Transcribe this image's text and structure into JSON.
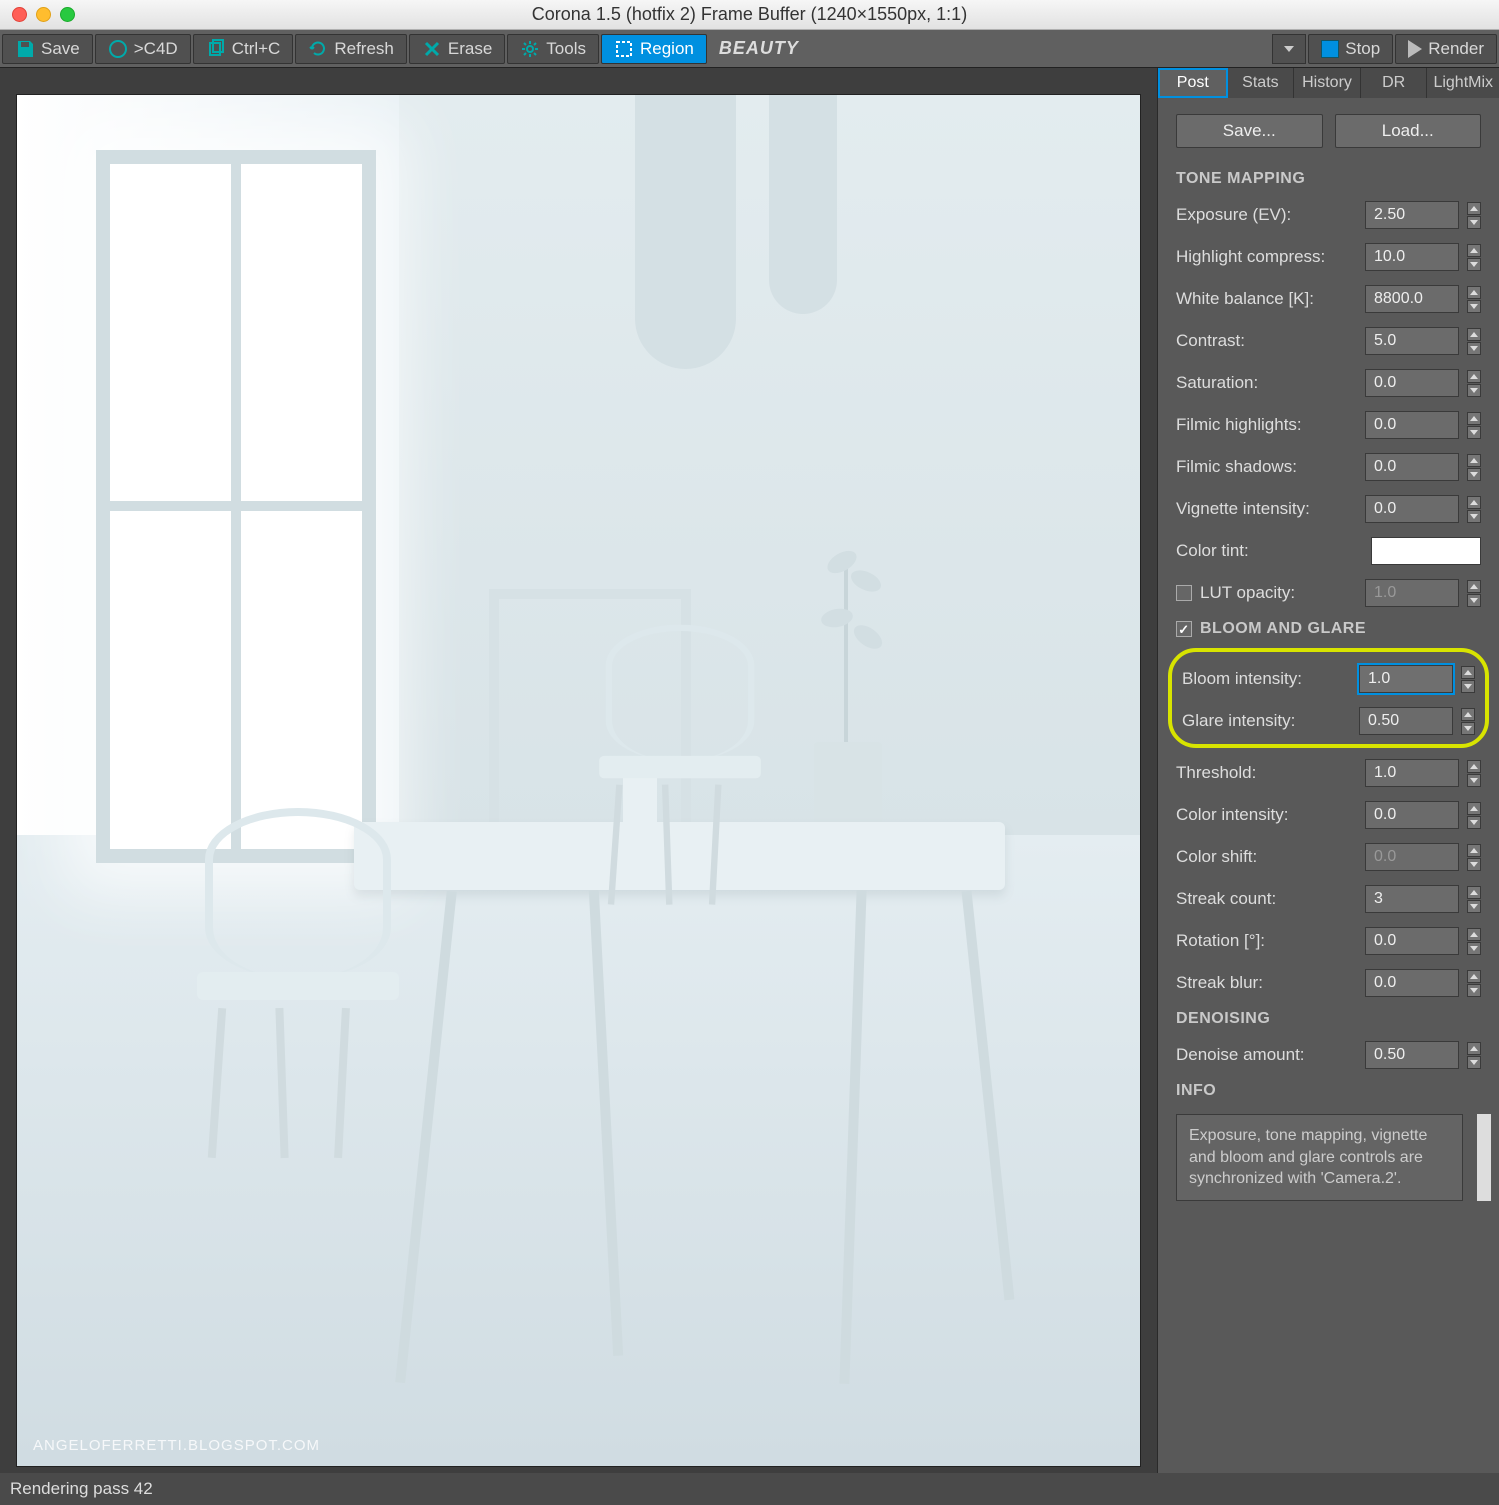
{
  "window": {
    "title": "Corona 1.5 (hotfix 2) Frame Buffer (1240×1550px, 1:1)"
  },
  "toolbar": {
    "save": "Save",
    "c4d": ">C4D",
    "copy": "Ctrl+C",
    "refresh": "Refresh",
    "erase": "Erase",
    "tools": "Tools",
    "region": "Region",
    "pass": "BEAUTY",
    "stop": "Stop",
    "render": "Render"
  },
  "viewport": {
    "watermark": "ANGELOFERRETTI.BLOGSPOT.COM"
  },
  "tabs": {
    "post": "Post",
    "stats": "Stats",
    "history": "History",
    "dr": "DR",
    "lightmix": "LightMix"
  },
  "panel": {
    "save": "Save...",
    "load": "Load...",
    "sections": {
      "tone": "TONE MAPPING",
      "bloom": "BLOOM AND GLARE",
      "denoise": "DENOISING",
      "info": "INFO"
    },
    "tone": {
      "exposure_label": "Exposure (EV):",
      "exposure": "2.50",
      "highlight_label": "Highlight compress:",
      "highlight": "10.0",
      "wb_label": "White balance [K]:",
      "wb": "8800.0",
      "contrast_label": "Contrast:",
      "contrast": "5.0",
      "saturation_label": "Saturation:",
      "saturation": "0.0",
      "filmic_hl_label": "Filmic highlights:",
      "filmic_hl": "0.0",
      "filmic_sh_label": "Filmic shadows:",
      "filmic_sh": "0.0",
      "vignette_label": "Vignette intensity:",
      "vignette": "0.0",
      "tint_label": "Color tint:",
      "lut_label": "LUT opacity:",
      "lut": "1.0"
    },
    "bloom": {
      "bloomint_label": "Bloom intensity:",
      "bloomint": "1.0",
      "glareint_label": "Glare intensity:",
      "glareint": "0.50",
      "threshold_label": "Threshold:",
      "threshold": "1.0",
      "colorint_label": "Color intensity:",
      "colorint": "0.0",
      "colorshift_label": "Color shift:",
      "colorshift": "0.0",
      "streak_label": "Streak count:",
      "streak": "3",
      "rotation_label": "Rotation [°]:",
      "rotation": "0.0",
      "blur_label": "Streak blur:",
      "blur": "0.0"
    },
    "denoise": {
      "amount_label": "Denoise amount:",
      "amount": "0.50"
    },
    "info_text": "Exposure, tone mapping, vignette and bloom and glare controls are synchronized with 'Camera.2'."
  },
  "status": "Rendering pass 42"
}
